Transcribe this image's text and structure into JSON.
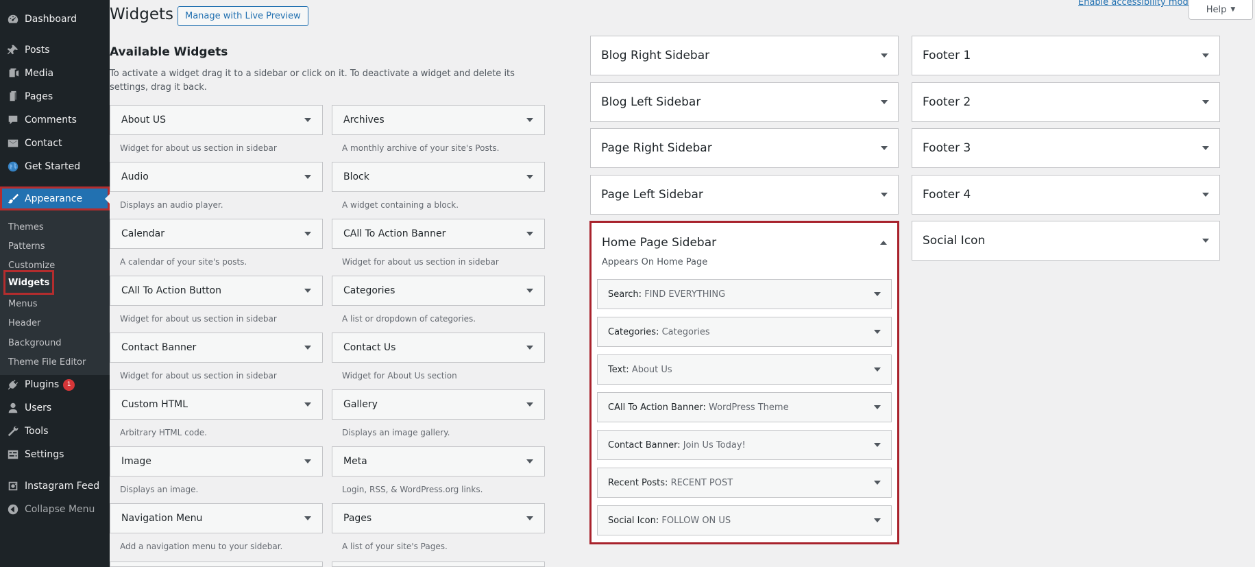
{
  "menu": {
    "items": [
      {
        "label": "Dashboard",
        "icon": "dashboard-icon"
      },
      {
        "label": "Posts",
        "icon": "pin-icon"
      },
      {
        "label": "Media",
        "icon": "media-icon"
      },
      {
        "label": "Pages",
        "icon": "page-icon"
      },
      {
        "label": "Comments",
        "icon": "comment-icon"
      },
      {
        "label": "Contact",
        "icon": "mail-icon"
      },
      {
        "label": "Get Started",
        "icon": "globe-icon"
      },
      {
        "label": "Appearance",
        "icon": "brush-icon"
      },
      {
        "label": "Plugins",
        "icon": "plugin-icon",
        "badge": "1"
      },
      {
        "label": "Users",
        "icon": "user-icon"
      },
      {
        "label": "Tools",
        "icon": "wrench-icon"
      },
      {
        "label": "Settings",
        "icon": "settings-icon"
      },
      {
        "label": "Instagram Feed",
        "icon": "instagram-icon"
      },
      {
        "label": "Collapse Menu",
        "icon": "collapse-icon"
      }
    ],
    "appearance_submenu": [
      "Themes",
      "Patterns",
      "Customize",
      "Widgets",
      "Menus",
      "Header",
      "Background",
      "Theme File Editor"
    ]
  },
  "header": {
    "title": "Widgets",
    "live_preview_label": "Manage with Live Preview",
    "accessibility_link": "Enable accessibility mode",
    "help_label": "Help"
  },
  "available": {
    "title": "Available Widgets",
    "description": "To activate a widget drag it to a sidebar or click on it. To deactivate a widget and delete its settings, drag it back.",
    "widgets": [
      {
        "title": "About US",
        "desc": "Widget for about us section in sidebar"
      },
      {
        "title": "Archives",
        "desc": "A monthly archive of your site's Posts."
      },
      {
        "title": "Audio",
        "desc": "Displays an audio player."
      },
      {
        "title": "Block",
        "desc": "A widget containing a block."
      },
      {
        "title": "Calendar",
        "desc": "A calendar of your site's posts."
      },
      {
        "title": "CAll To Action Banner",
        "desc": "Widget for about us section in sidebar"
      },
      {
        "title": "CAll To Action Button",
        "desc": "Widget for about us section in sidebar"
      },
      {
        "title": "Categories",
        "desc": "A list or dropdown of categories."
      },
      {
        "title": "Contact Banner",
        "desc": "Widget for about us section in sidebar"
      },
      {
        "title": "Contact Us",
        "desc": "Widget for About Us section"
      },
      {
        "title": "Custom HTML",
        "desc": "Arbitrary HTML code."
      },
      {
        "title": "Gallery",
        "desc": "Displays an image gallery."
      },
      {
        "title": "Image",
        "desc": "Displays an image."
      },
      {
        "title": "Meta",
        "desc": "Login, RSS, & WordPress.org links."
      },
      {
        "title": "Navigation Menu",
        "desc": "Add a navigation menu to your sidebar."
      },
      {
        "title": "Pages",
        "desc": "A list of your site's Pages."
      }
    ]
  },
  "sidebars": {
    "left_column": [
      "Blog Right Sidebar",
      "Blog Left Sidebar",
      "Page Right Sidebar",
      "Page Left Sidebar"
    ],
    "right_column": [
      "Footer 1",
      "Footer 2",
      "Footer 3",
      "Footer 4",
      "Social Icon"
    ],
    "home": {
      "title": "Home Page Sidebar",
      "description": "Appears On Home Page",
      "widgets": [
        {
          "name": "Search",
          "instance": "FIND EVERYTHING"
        },
        {
          "name": "Categories",
          "instance": "Categories"
        },
        {
          "name": "Text",
          "instance": "About Us"
        },
        {
          "name": "CAll To Action Banner",
          "instance": "WordPress Theme"
        },
        {
          "name": "Contact Banner",
          "instance": "Join Us Today!"
        },
        {
          "name": "Recent Posts",
          "instance": "RECENT POST"
        },
        {
          "name": "Social Icon",
          "instance": "FOLLOW ON US"
        }
      ]
    }
  },
  "colors": {
    "accent": "#2271b1",
    "highlight_border": "#a8222c",
    "menu_bg": "#1d2327"
  }
}
